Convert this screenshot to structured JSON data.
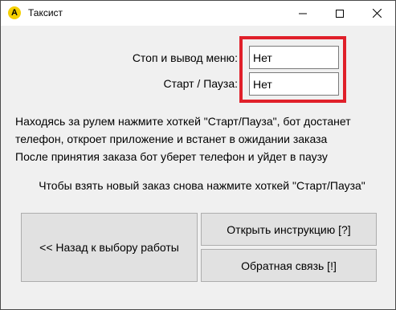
{
  "window": {
    "title": "Таксист",
    "icon_glyph": "A",
    "icon_color": "#f5d000"
  },
  "settings": {
    "stop_label": "Стоп и вывод меню:",
    "stop_value": "Нет",
    "start_label": "Старт / Пауза:",
    "start_value": "Нет",
    "highlight_color": "#e0202a"
  },
  "info": {
    "line1": "Находясь за рулем нажмите хоткей \"Старт/Пауза\", бот достанет",
    "line2": "телефон, откроет приложение и встанет в ожидании заказа",
    "line3": "После принятия заказа бот уберет телефон и уйдет в паузу"
  },
  "hint": "Чтобы взять новый заказ снова нажмите хоткей \"Старт/Пауза\"",
  "buttons": {
    "back": "<< Назад к выбору работы",
    "instructions": "Открыть инструкцию [?]",
    "feedback": "Обратная связь [!]"
  }
}
